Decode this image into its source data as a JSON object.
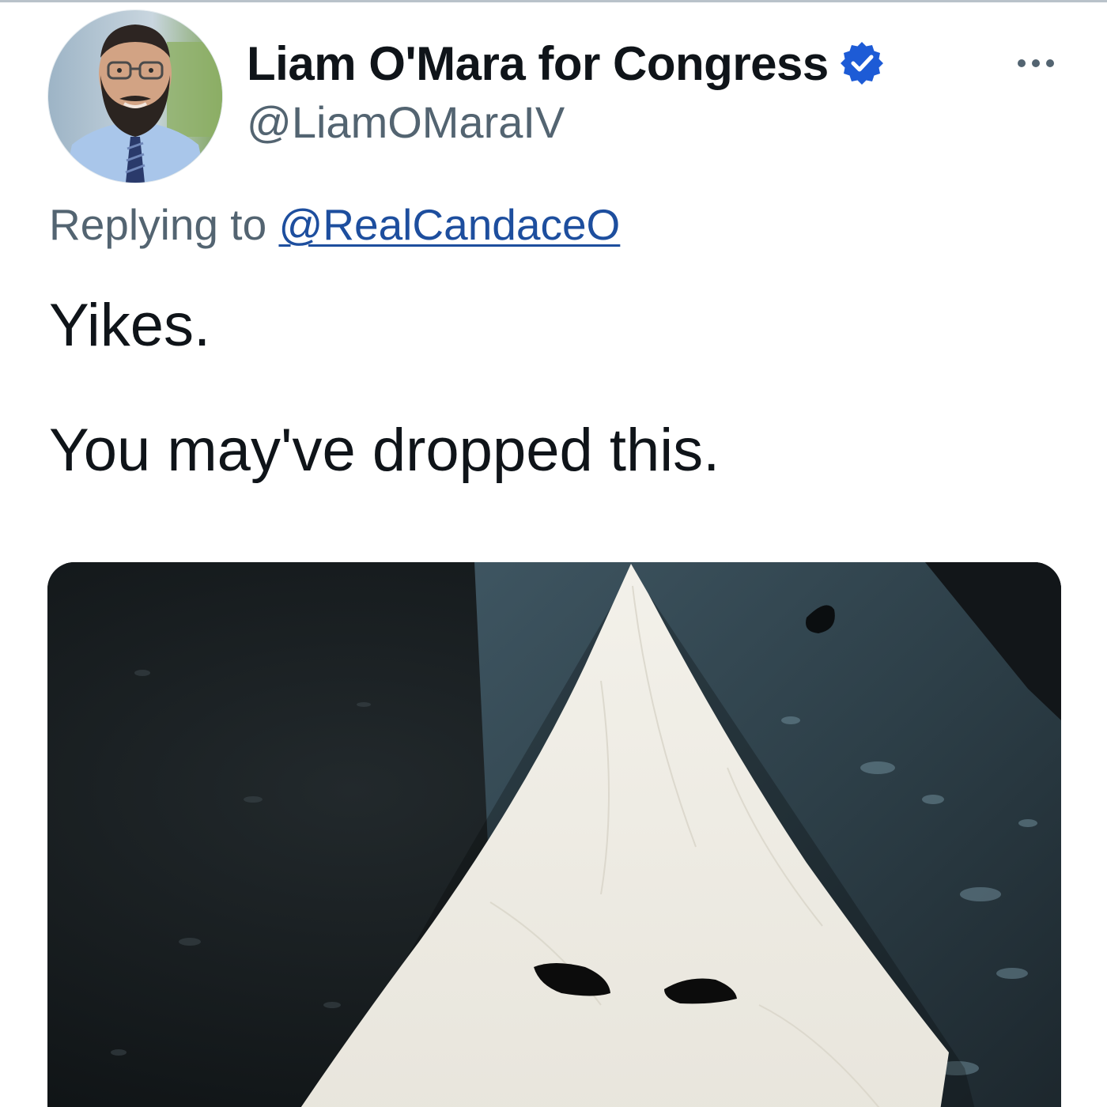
{
  "tweet": {
    "author": {
      "display_name": "Liam O'Mara for Congress",
      "handle": "@LiamOMaraIV",
      "verified": true,
      "avatar_icon": "profile-photo"
    },
    "reply_context": {
      "prefix": "Replying to ",
      "mention": "@RealCandaceO"
    },
    "text_lines": [
      "Yikes.",
      "You may've dropped this."
    ],
    "media": {
      "type": "photo"
    },
    "colors": {
      "verified_badge": "#1d5bd6",
      "link": "#1d4e9e",
      "secondary_text": "#536471",
      "primary_text": "#0f1419"
    }
  }
}
